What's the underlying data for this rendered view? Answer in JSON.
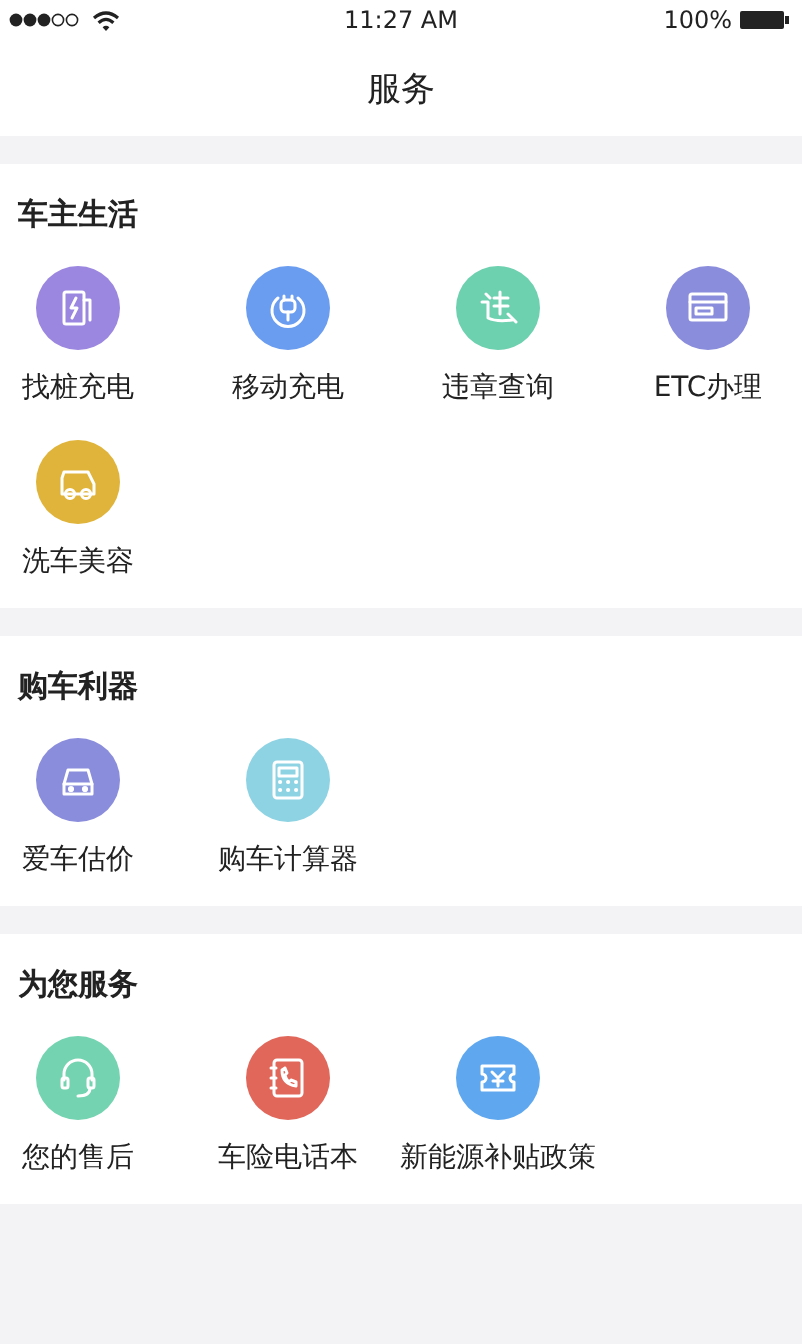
{
  "status_bar": {
    "time": "11:27 AM",
    "battery": "100%"
  },
  "title": "服务",
  "sections": [
    {
      "title": "车主生活",
      "items": [
        {
          "label": "找桩充电",
          "color": "#9b86e0"
        },
        {
          "label": "移动充电",
          "color": "#6a9cf0"
        },
        {
          "label": "违章查询",
          "color": "#6dd0ae"
        },
        {
          "label": "ETC办理",
          "color": "#8a8cdc"
        },
        {
          "label": "洗车美容",
          "color": "#e0b43a"
        }
      ]
    },
    {
      "title": "购车利器",
      "items": [
        {
          "label": "爱车估价",
          "color": "#8a8cdc"
        },
        {
          "label": "购车计算器",
          "color": "#8ed3e3"
        }
      ]
    },
    {
      "title": "为您服务",
      "items": [
        {
          "label": "您的售后",
          "color": "#74d3b0"
        },
        {
          "label": "车险电话本",
          "color": "#e0675a"
        },
        {
          "label": "新能源补贴政策",
          "color": "#5fa8ef"
        }
      ]
    }
  ]
}
